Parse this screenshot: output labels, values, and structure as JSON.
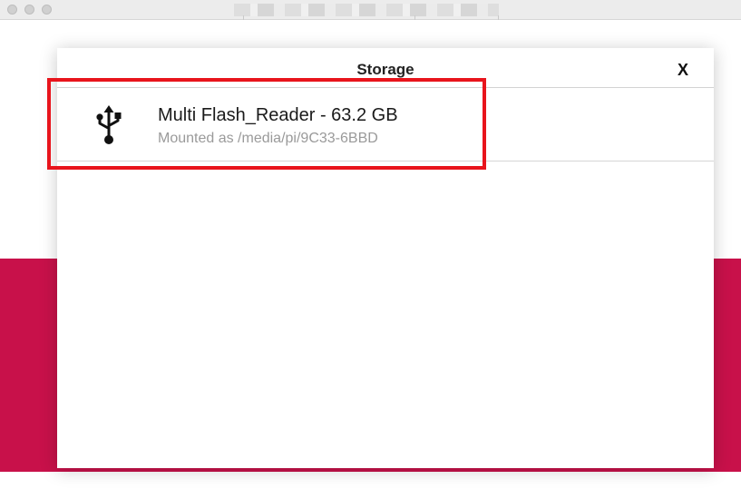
{
  "window": {
    "title_blurred": true
  },
  "dialog": {
    "title": "Storage",
    "close_label": "X",
    "devices": [
      {
        "name": "Multi Flash_Reader - 63.2 GB",
        "subtitle": "Mounted as /media/pi/9C33-6BBD",
        "icon": "usb-icon"
      }
    ]
  },
  "colors": {
    "brand_band": "#c8114a",
    "highlight": "#e8141c",
    "subtitle_text": "#9a9a9a"
  }
}
